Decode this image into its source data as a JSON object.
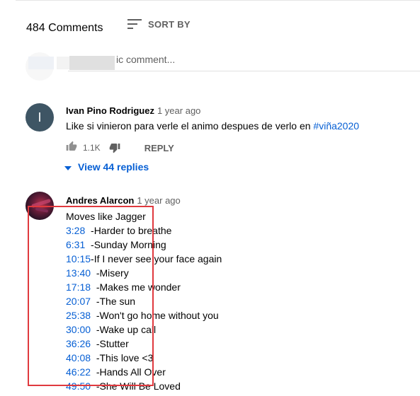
{
  "header": {
    "comment_count": "484 Comments",
    "sort_label": "SORT BY",
    "sort_icon": "sort-icon"
  },
  "add_comment": {
    "placeholder": "ic comment..."
  },
  "comments": [
    {
      "author": "Ivan Pino Rodriguez",
      "time": "1 year ago",
      "avatar_letter": "I",
      "avatar_color": "#3e5564",
      "text": "Like si vinieron para verle el animo despues de verlo en ",
      "hashtag": "#viña2020",
      "likes": "1.1K",
      "reply_label": "REPLY",
      "view_replies": "View 44 replies"
    },
    {
      "author": "Andres Alarcon",
      "time": "1 year ago",
      "first_line": "Moves like Jagger",
      "tracks": [
        {
          "time": "3:28",
          "title": "  -Harder to breathe"
        },
        {
          "time": "6:31",
          "title": "  -Sunday Morning"
        },
        {
          "time": "10:15",
          "title": "-If I never see your face again"
        },
        {
          "time": "13:40",
          "title": "  -Misery"
        },
        {
          "time": "17:18",
          "title": "  -Makes me wonder"
        },
        {
          "time": "20:07",
          "title": "  -The sun"
        },
        {
          "time": "25:38",
          "title": "  -Won't go home without you"
        },
        {
          "time": "30:00",
          "title": "  -Wake up call"
        },
        {
          "time": "36:26",
          "title": "  -Stutter"
        },
        {
          "time": "40:08",
          "title": "  -This love <3"
        },
        {
          "time": "46:22",
          "title": "  -Hands All Over"
        },
        {
          "time": "49:50",
          "title": "  -She Will Be Loved"
        }
      ]
    }
  ],
  "colors": {
    "link": "#065fd4",
    "secondary_text": "#606060",
    "highlight_box": "#e0393e"
  }
}
